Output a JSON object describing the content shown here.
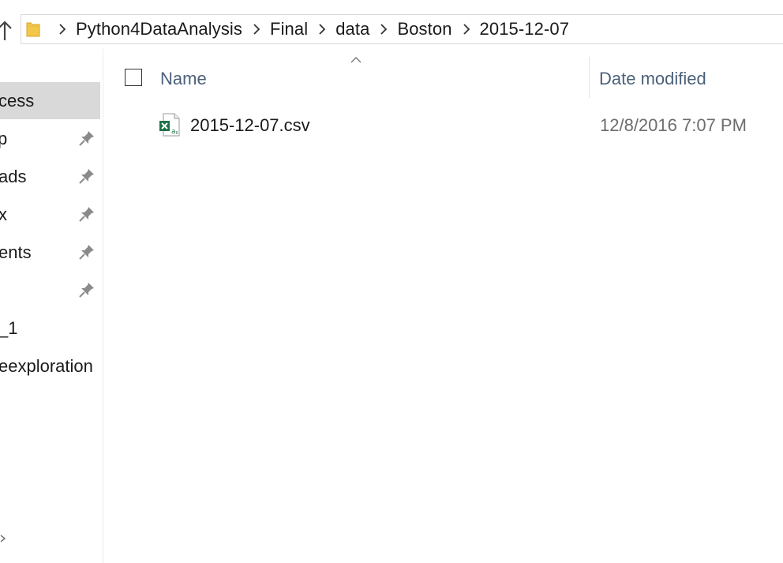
{
  "address_bar": {
    "breadcrumbs": [
      "Python4DataAnalysis",
      "Final",
      "data",
      "Boston",
      "2015-12-07"
    ]
  },
  "sidebar": {
    "items": [
      {
        "label": "cess",
        "pinned": false,
        "selected": true
      },
      {
        "label": "p",
        "pinned": true,
        "selected": false
      },
      {
        "label": "ads",
        "pinned": true,
        "selected": false
      },
      {
        "label": "x",
        "pinned": true,
        "selected": false
      },
      {
        "label": "ents",
        "pinned": true,
        "selected": false
      },
      {
        "label": "",
        "pinned": true,
        "selected": false
      },
      {
        "label": "_1",
        "pinned": false,
        "selected": false
      },
      {
        "label": "eexploration",
        "pinned": false,
        "selected": false
      }
    ]
  },
  "file_list": {
    "columns": {
      "name": "Name",
      "date_modified": "Date modified"
    },
    "files": [
      {
        "name": "2015-12-07.csv",
        "date_modified": "12/8/2016 7:07 PM",
        "icon": "excel-csv-icon"
      }
    ]
  }
}
